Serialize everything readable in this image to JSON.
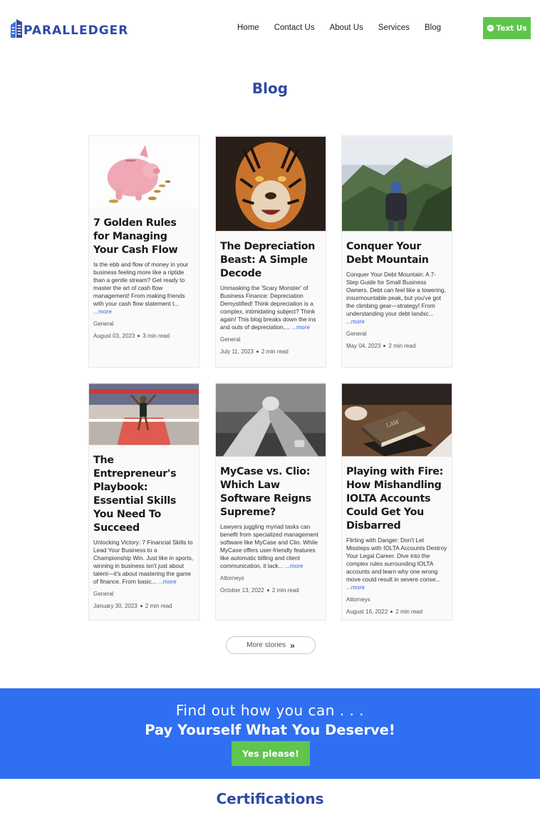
{
  "brand": {
    "name": "PARALLEDGER",
    "color": "#2f49a6"
  },
  "nav": {
    "items": [
      "Home",
      "Contact Us",
      "About Us",
      "Services",
      "Blog"
    ]
  },
  "text_us_button": {
    "label": "Text Us",
    "icon": "chat-bubble-icon",
    "color": "#5fc54c"
  },
  "page": {
    "title": "Blog"
  },
  "posts": [
    {
      "title": "7 Golden Rules for Managing Your Cash Flow",
      "excerpt": "Is the ebb and flow of money in your business feeling more like a riptide than a gentle stream? Get ready to master the art of cash flow management! From making friends with your cash flow statement t...",
      "more": "...more",
      "category": "General",
      "date": "August 03, 2023",
      "read_time": "3 min read",
      "image": "piggy-bank-photo"
    },
    {
      "title": "The Depreciation Beast: A Simple Decode",
      "excerpt": "Unmasking the 'Scary Monster' of Business Finance: Depreciation Demystified! Think depreciation is a complex, intimidating subject? Think again! This blog breaks down the ins and outs of depreciation,...",
      "more": "...more",
      "category": "General",
      "date": "July 11, 2023",
      "read_time": "2 min read",
      "image": "tiger-photo"
    },
    {
      "title": "Conquer Your Debt Mountain",
      "excerpt": "Conquer Your Debt Mountain: A 7-Step Guide for Small Business Owners. Debt can feel like a towering, insurmountable peak, but you've got the climbing gear—strategy! From understanding your debt landsc...",
      "more": "...more",
      "category": "General",
      "date": "May 04, 2023",
      "read_time": "2 min read",
      "image": "hiker-mountain-photo"
    },
    {
      "title": "The Entrepreneur's Playbook: Essential Skills You Need To Succeed",
      "excerpt": "Unlocking Victory: 7 Financial Skills to Lead Your Business to a Championship Win. Just like in sports, winning in business isn't just about talent—it's about mastering the game of finance. From basic...",
      "more": "...more",
      "category": "General",
      "date": "January 30, 2023",
      "read_time": "2 min read",
      "image": "marathon-finish-photo"
    },
    {
      "title": "MyCase vs. Clio: Which Law Software Reigns Supreme?",
      "excerpt": "Lawyers juggling myriad tasks can benefit from specialized management software like MyCase and Clio. While MyCase offers user-friendly features like automatic billing and client communication, it lack...",
      "more": "...more",
      "category": "Attorneys",
      "date": "October 13, 2022",
      "read_time": "2 min read",
      "image": "arm-wrestling-photo"
    },
    {
      "title": "Playing with Fire: How Mishandling IOLTA Accounts Could Get You Disbarred",
      "excerpt": "Flirting with Danger: Don't Let Missteps with IOLTA Accounts Destroy Your Legal Career. Dive into the complex rules surrounding IOLTA accounts and learn why one wrong move could result in severe conse...",
      "more": "...more",
      "category": "Attorneys",
      "date": "August 16, 2022",
      "read_time": "2 min read",
      "image": "law-book-photo"
    }
  ],
  "more_stories": {
    "label": "More stories",
    "icon": "double-chevron-right-icon"
  },
  "cta": {
    "line1": "Find out how you can . . .",
    "line2": "Pay Yourself What You Deserve!",
    "button": "Yes please!",
    "background": "#2f6ff2"
  },
  "certifications": {
    "title": "Certifications"
  }
}
